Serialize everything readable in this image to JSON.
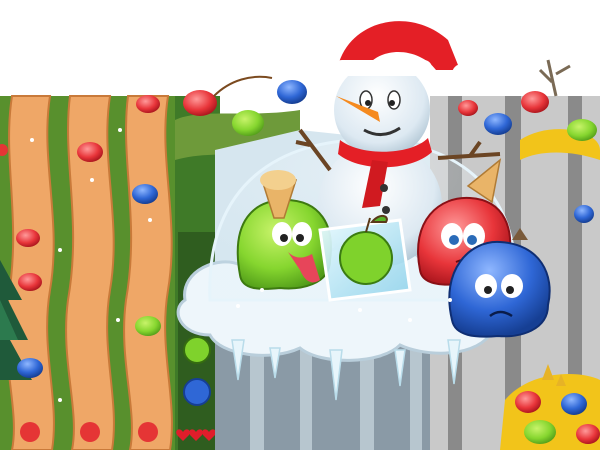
{
  "scene": {
    "left_panel": {
      "track_colors": {
        "path": "#efa767",
        "grass": "#58902d",
        "edge": "#c97a3a"
      },
      "hud": {
        "lives": 3,
        "apple_icons": [
          "green-apple-icon",
          "blue-apple-icon",
          "red-apple-icon"
        ]
      }
    },
    "center_panel": {
      "colors": {
        "snow": "#e8f4fb",
        "rock": "#8a9aa6",
        "ice": "#b9e2f2"
      }
    },
    "right_panel": {
      "colors": {
        "ground": "#c9c9c9",
        "sand": "#f2c41a"
      }
    },
    "characters": [
      "snowman-with-santa-hat",
      "green-jelly-blob-with-ice-cream-cone",
      "red-jelly-blob-with-ice-cream-cone",
      "blue-jelly-blob",
      "green-apple-in-ice-cube"
    ],
    "palette": {
      "red": "#e53535",
      "green": "#7fd22c",
      "blue": "#2f67d6",
      "snow": "#f5fbff",
      "hat": "#e41f26"
    }
  }
}
